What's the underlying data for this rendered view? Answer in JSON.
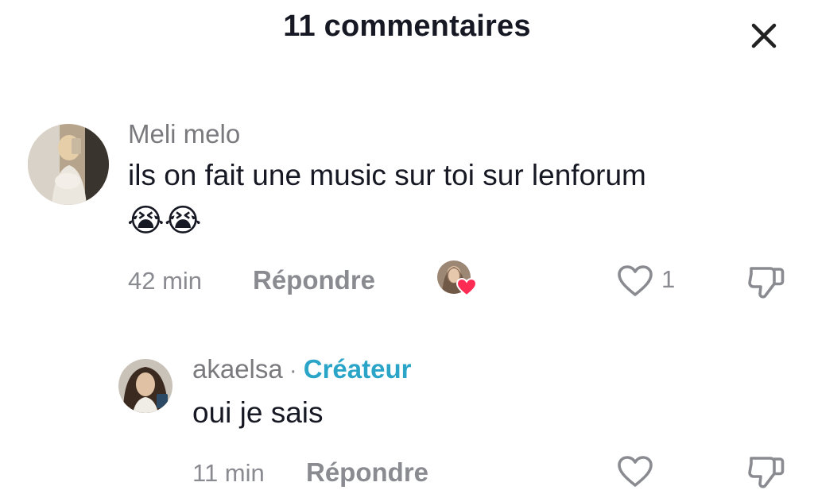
{
  "header": {
    "title": "11 commentaires",
    "close_icon": "close-icon"
  },
  "comments": [
    {
      "username": "Meli melo",
      "text": "ils on fait une music sur toi sur lenforum",
      "emoji": "😭😭",
      "time": "42 min",
      "reply_label": "Répondre",
      "like_count": "1",
      "creator_liked": true,
      "heart_color": "#fe2c55"
    },
    {
      "username": "akaelsa",
      "separator": "·",
      "badge": "Créateur",
      "text": "oui je sais",
      "time": "11 min",
      "reply_label": "Répondre"
    }
  ],
  "colors": {
    "accent_creator": "#2aa5c8",
    "text_primary": "#161823",
    "text_secondary": "#8a8b91"
  }
}
